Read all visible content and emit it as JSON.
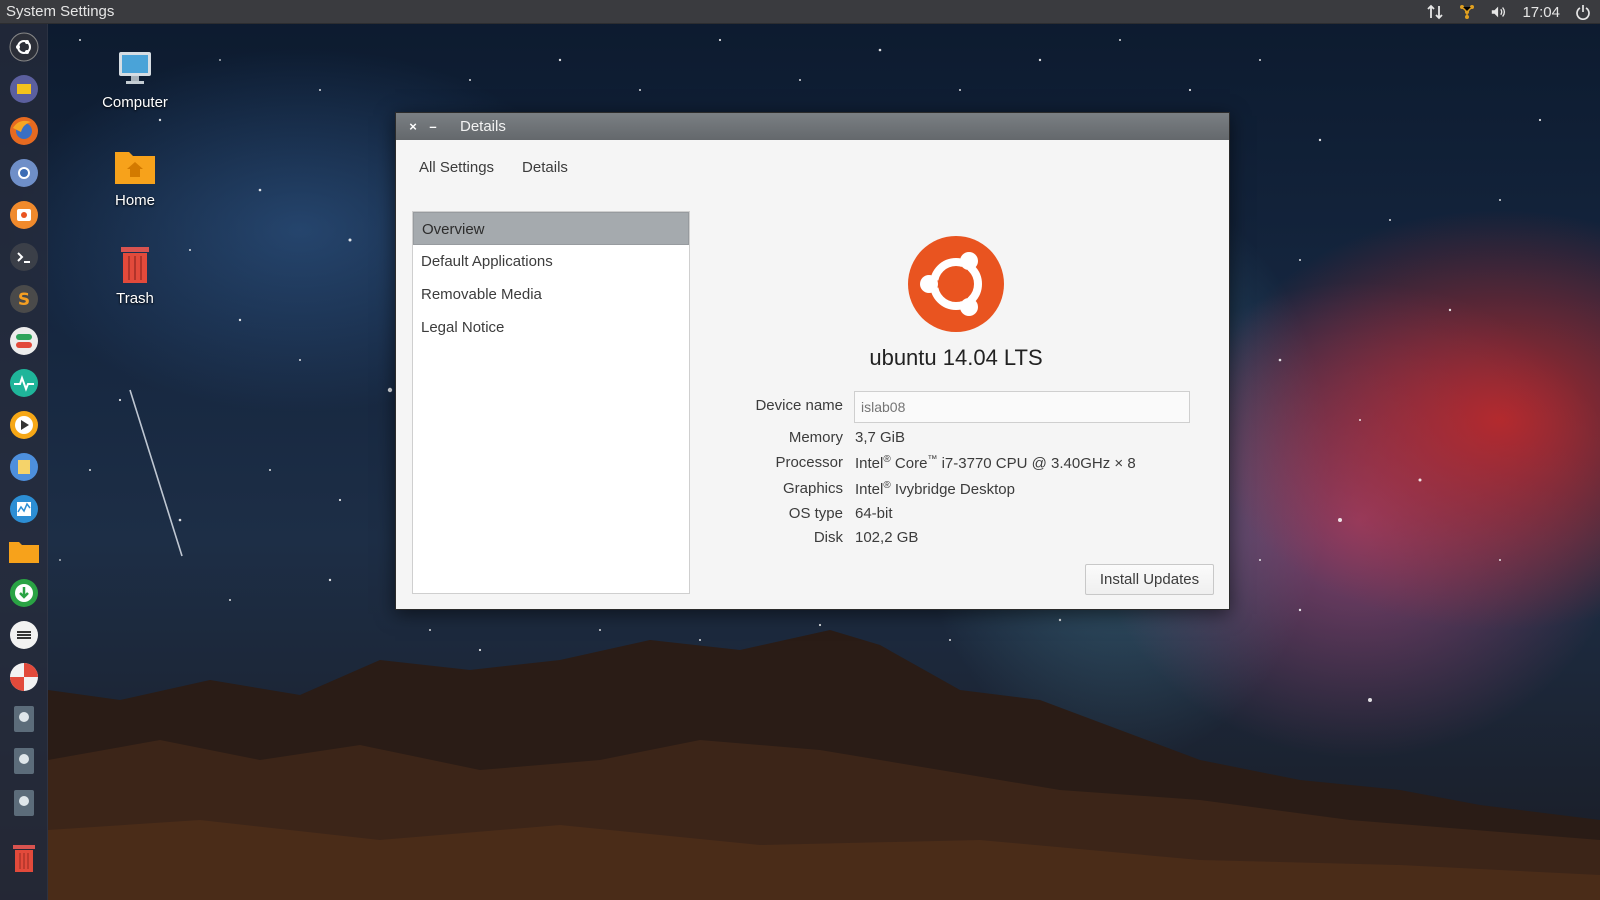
{
  "top_panel": {
    "app_title": "System Settings",
    "clock": "17:04",
    "tray_icons": [
      "network-arrows-icon",
      "updates-icon",
      "volume-icon",
      "power-icon"
    ]
  },
  "launcher": {
    "items": [
      "dash-home-icon",
      "files-icon",
      "firefox-icon",
      "chromium-icon",
      "software-center-icon",
      "terminal-icon",
      "sublime-text-icon",
      "settings-toggle-icon",
      "system-monitor-icon",
      "media-player-icon",
      "text-editor-icon",
      "activity-monitor-icon",
      "folder-icon",
      "download-manager-icon",
      "disks-icon",
      "disk-usage-icon",
      "drive-icon-1",
      "drive-icon-2",
      "drive-icon-3",
      "trash-icon"
    ]
  },
  "desktop": {
    "icons": [
      {
        "label": "Computer",
        "icon": "computer-icon"
      },
      {
        "label": "Home",
        "icon": "home-folder-icon"
      },
      {
        "label": "Trash",
        "icon": "trash-icon"
      }
    ]
  },
  "window": {
    "title": "Details",
    "close_glyph": "×",
    "minimize_glyph": "–",
    "breadcrumbs": [
      "All Settings",
      "Details"
    ],
    "nav": {
      "items": [
        "Overview",
        "Default Applications",
        "Removable Media",
        "Legal Notice"
      ],
      "selected": "Overview"
    },
    "os_title": "ubuntu 14.04 LTS",
    "device_name": {
      "label": "Device name",
      "placeholder": "islab08"
    },
    "info": {
      "memory": {
        "label": "Memory",
        "value": "3,7 GiB"
      },
      "processor": {
        "label": "Processor",
        "value_prefix": "Intel",
        "reg": "®",
        "core": " Core",
        "tm": "™",
        "value_suffix": " i7-3770 CPU @ 3.40GHz × 8"
      },
      "graphics": {
        "label": "Graphics",
        "value_prefix": "Intel",
        "reg": "®",
        "value_suffix": " Ivybridge Desktop"
      },
      "os_type": {
        "label": "OS type",
        "value": "64-bit"
      },
      "disk": {
        "label": "Disk",
        "value": "102,2 GB"
      }
    },
    "install_button": "Install Updates"
  },
  "colors": {
    "ubuntu_orange": "#e95420",
    "titlebar": "#6f7478",
    "selected_row": "#a5aaae"
  }
}
